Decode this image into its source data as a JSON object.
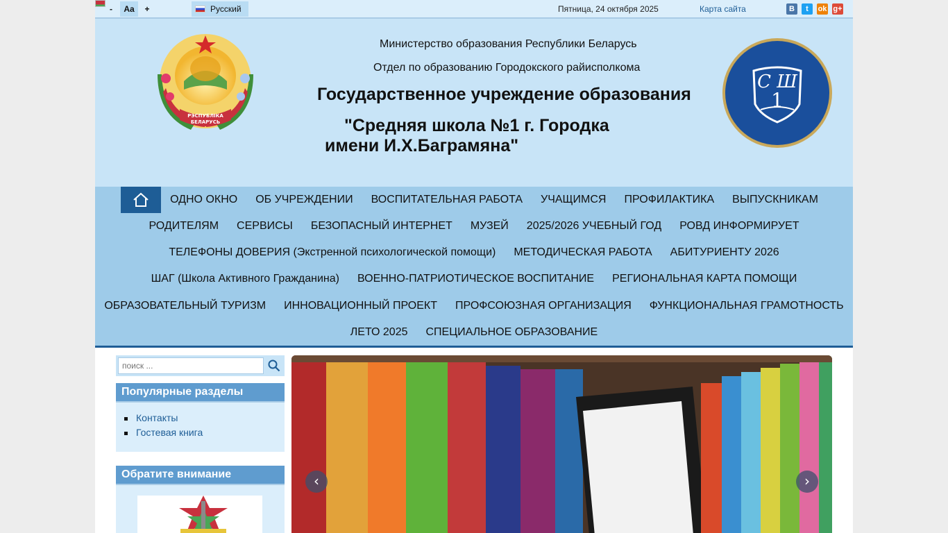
{
  "topbar": {
    "font_minus": "-",
    "font_normal": "Aa",
    "font_plus": "+",
    "language": "Русский",
    "date": "Пятница, 24 октября 2025",
    "sitemap": "Карта сайта",
    "social": {
      "vk": "В",
      "twitter": "t",
      "ok": "ok",
      "gplus": "g+"
    }
  },
  "header": {
    "ministry": "Министерство образования Республики Беларусь",
    "department": "Отдел по образованию Городокского райисполкома",
    "institution_type": "Государственное учреждение образования",
    "school_name_line1": "\"Средняя школа №1 г. Городка",
    "school_name_line2": "имени И.Х.Баграмяна\"",
    "emblem_text": "РЭСПУБЛІКА БЕЛАРУСЬ",
    "logo_text_top": "СШ",
    "logo_text_num": "1"
  },
  "nav": {
    "rows": [
      [
        "ОДНО ОКНО",
        "ОБ УЧРЕЖДЕНИИ",
        "ВОСПИТАТЕЛЬНАЯ РАБОТА",
        "УЧАЩИМСЯ",
        "ПРОФИЛАКТИКА",
        "ВЫПУСКНИКАМ"
      ],
      [
        "РОДИТЕЛЯМ",
        "СЕРВИСЫ",
        "БЕЗОПАСНЫЙ ИНТЕРНЕТ",
        "МУЗЕЙ",
        "2025/2026 УЧЕБНЫЙ ГОД",
        "РОВД ИНФОРМИРУЕТ"
      ],
      [
        "ТЕЛЕФОНЫ ДОВЕРИЯ (Экстренной психологической помощи)",
        "МЕТОДИЧЕСКАЯ РАБОТА",
        "АБИТУРИЕНТУ 2026"
      ],
      [
        "ШАГ (Школа Активного Гражданина)",
        "ВОЕННО-ПАТРИОТИЧЕСКОЕ ВОСПИТАНИЕ",
        "РЕГИОНАЛЬНАЯ КАРТА ПОМОЩИ"
      ],
      [
        "ОБРАЗОВАТЕЛЬНЫЙ ТУРИЗМ",
        "ИННОВАЦИОННЫЙ ПРОЕКТ",
        "ПРОФСОЮЗНАЯ ОРГАНИЗАЦИЯ",
        "ФУНКЦИОНАЛЬНАЯ ГРАМОТНОСТЬ"
      ],
      [
        "ЛЕТО 2025",
        "СПЕЦИАЛЬНОЕ ОБРАЗОВАНИЕ"
      ]
    ]
  },
  "sidebar": {
    "search_placeholder": "поиск ...",
    "popular_title": "Популярные разделы",
    "popular_items": [
      "Контакты",
      "Гостевая книга"
    ],
    "attention_title": "Обратите внимание"
  },
  "slider": {
    "prev": "‹",
    "next": "›"
  },
  "colors": {
    "header_bg": "#c8e4f7",
    "nav_bg": "#9ecbe9",
    "accent": "#1e5d96",
    "module_title_bg": "#5f9ccf"
  }
}
